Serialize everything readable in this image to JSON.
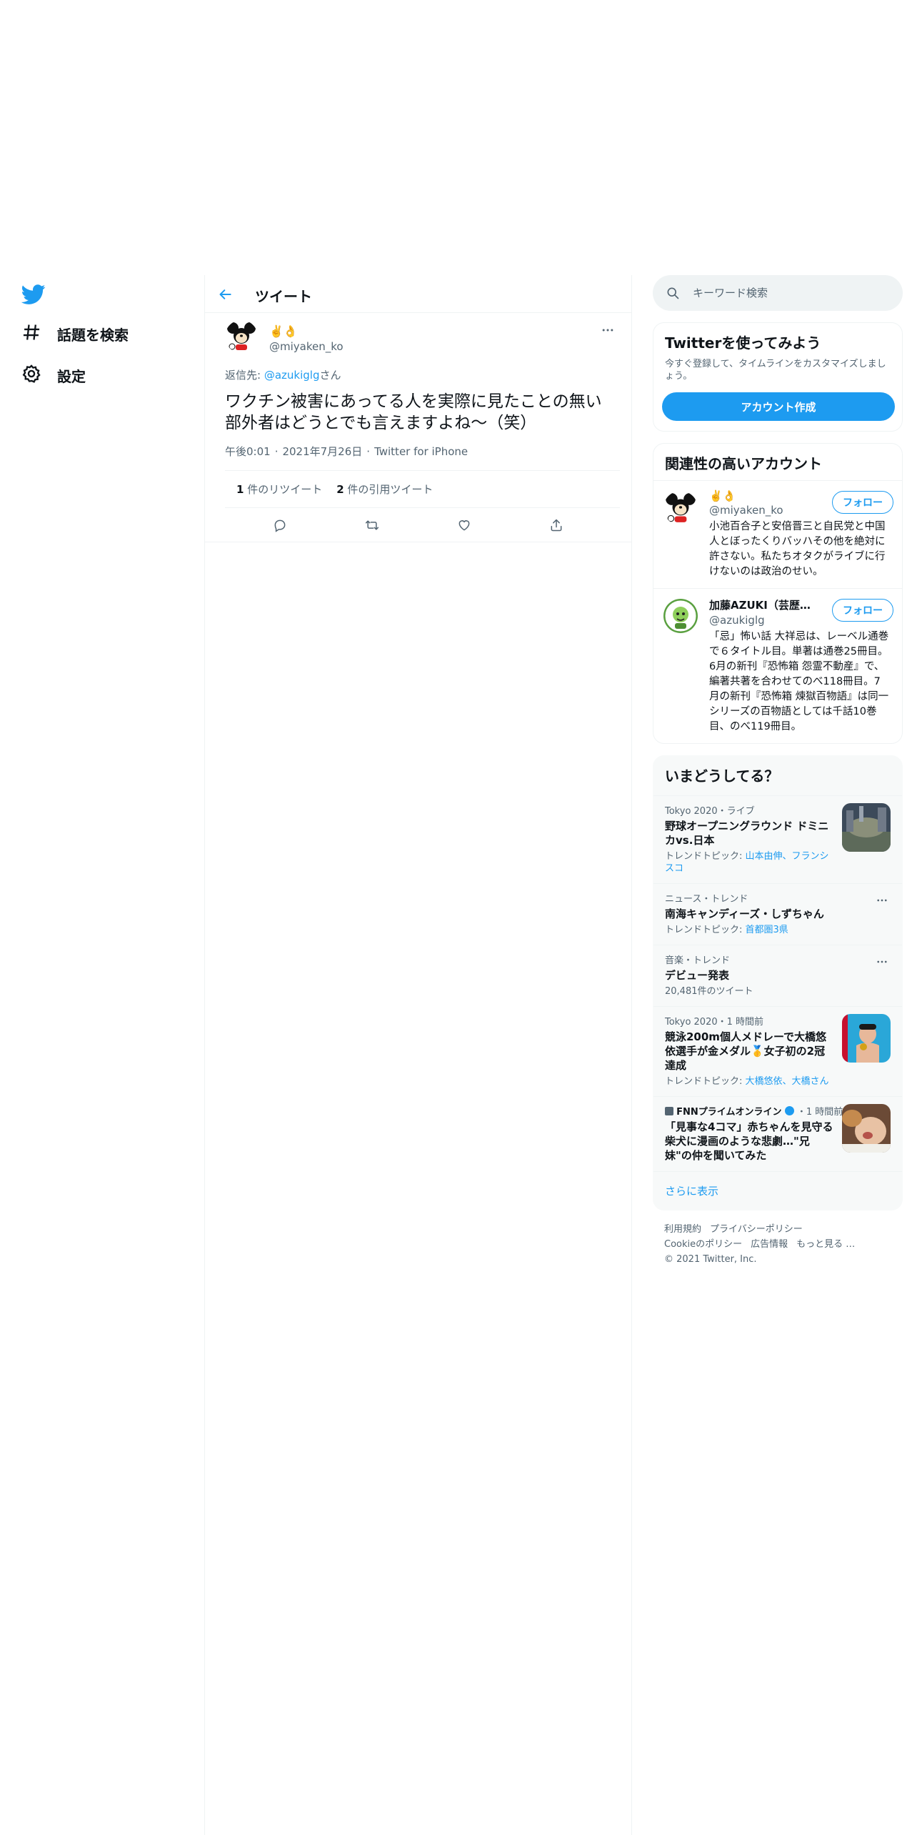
{
  "sidebar": {
    "logo_icon": "twitter-bird-icon",
    "items": [
      {
        "label": "話題を検索",
        "icon": "hashtag-icon"
      },
      {
        "label": "設定",
        "icon": "gear-icon"
      }
    ]
  },
  "header": {
    "title": "ツイート"
  },
  "tweet": {
    "author_name": "✌️👌",
    "author_handle": "@miyaken_ko",
    "reply_prefix": "返信先: ",
    "reply_mention": "@azukiglg",
    "reply_suffix": "さん",
    "text": "ワクチン被害にあってる人を実際に見たことの無い部外者はどうとでも言えますよね〜（笑）",
    "time": "午後0:01",
    "date": "2021年7月26日",
    "source": "Twitter for iPhone",
    "separator": "·",
    "retweets_count": "1",
    "retweets_label": " 件のリツイート",
    "quotes_count": "2",
    "quotes_label": " 件の引用ツイート"
  },
  "search": {
    "placeholder": "キーワード検索"
  },
  "signup": {
    "title": "Twitterを使ってみよう",
    "description": "今すぐ登録して、タイムラインをカスタマイズしましょう。",
    "button": "アカウント作成"
  },
  "related": {
    "title": "関連性の高いアカウント",
    "users": [
      {
        "name": "✌️👌",
        "handle": "@miyaken_ko",
        "bio": "小池百合子と安倍晋三と自民党と中国人とぼったくりバッハその他を絶対に許さない。私たちオタクがライブに行けないのは政治のせい。",
        "follow": "フォロー"
      },
      {
        "name": "加藤AZUKI（芸歴三十",
        "handle": "@azukiglg",
        "bio": "「忌」怖い話 大祥忌は、レーベル通巻で６タイトル目。単著は通巻25冊目。6月の新刊『恐怖箱 怨霊不動産』で、編著共著を合わせてのべ118冊目。7月の新刊『恐怖箱 煉獄百物語』は同一シリーズの百物語としては千話10巻目、のべ119冊目。",
        "follow": "フォロー"
      }
    ]
  },
  "trends": {
    "title": "いまどうしてる？",
    "items": [
      {
        "meta": "Tokyo 2020・ライブ",
        "title": "野球オープニングラウンド ドミニカvs.日本",
        "sub_prefix": "トレンドトピック: ",
        "sub_links": "山本由伸、フランシスコ"
      },
      {
        "meta": "ニュース・トレンド",
        "title": "南海キャンディーズ・しずちゃん",
        "sub_prefix": "トレンドトピック: ",
        "sub_links": "首都圏3県"
      },
      {
        "meta": "音楽・トレンド",
        "title": "デビュー発表",
        "sub_prefix": "20,481件のツイート",
        "sub_links": ""
      },
      {
        "meta": "Tokyo 2020・1 時間前",
        "title": "競泳200m個人メドレーで大橋悠依選手が金メダル🥇女子初の2冠達成",
        "sub_prefix": "トレンドトピック: ",
        "sub_links": "大橋悠依、大橋さん"
      },
      {
        "meta_source": "FNNプライムオンライン",
        "meta_time": "・1 時間前",
        "title": "「見事な4コマ」赤ちゃんを見守る柴犬に漫画のような悲劇…\"兄妹\"の仲を聞いてみた"
      }
    ],
    "show_more": "さらに表示"
  },
  "footer": {
    "links": [
      "利用規約",
      "プライバシーポリシー",
      "Cookieのポリシー",
      "広告情報",
      "もっと見る …"
    ],
    "copyright": "© 2021 Twitter, Inc."
  },
  "colors": {
    "accent": "#1d9bf0",
    "text": "#0f1419",
    "secondary": "#536471",
    "border": "#eff3f4"
  }
}
